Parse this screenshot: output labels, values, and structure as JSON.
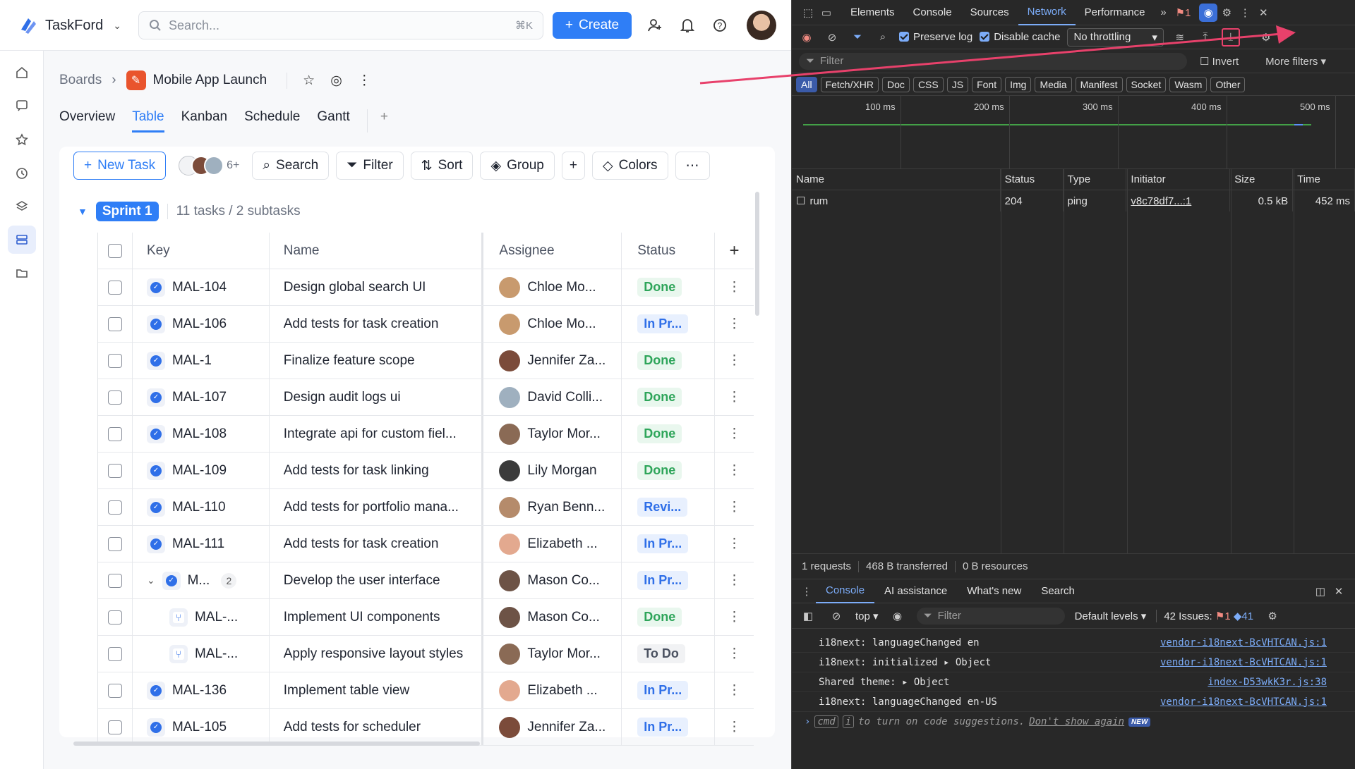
{
  "app": {
    "name": "TaskFord"
  },
  "topbar": {
    "search_placeholder": "Search...",
    "search_shortcut": "⌘K",
    "create_label": "Create"
  },
  "breadcrumb": {
    "root": "Boards",
    "project": "Mobile App Launch"
  },
  "tabs": [
    "Overview",
    "Table",
    "Kanban",
    "Schedule",
    "Gantt"
  ],
  "active_tab": "Table",
  "toolbar": {
    "new_task": "New Task",
    "members_more": "6+",
    "search": "Search",
    "filter": "Filter",
    "sort": "Sort",
    "group": "Group",
    "colors": "Colors"
  },
  "sprint": {
    "name": "Sprint 1",
    "info": "11 tasks / 2 subtasks"
  },
  "table": {
    "headers": {
      "key": "Key",
      "name": "Name",
      "assignee": "Assignee",
      "status": "Status"
    },
    "rows": [
      {
        "key": "MAL-104",
        "name": "Design global search UI",
        "assignee": "Chloe Mo...",
        "status": "Done",
        "avatar_color": "#c89a6e"
      },
      {
        "key": "MAL-106",
        "name": "Add tests for task creation",
        "assignee": "Chloe Mo...",
        "status": "In Pr...",
        "avatar_color": "#c89a6e"
      },
      {
        "key": "MAL-1",
        "name": "Finalize feature scope",
        "assignee": "Jennifer Za...",
        "status": "Done",
        "avatar_color": "#7b4b3a"
      },
      {
        "key": "MAL-107",
        "name": "Design audit logs ui",
        "assignee": "David Colli...",
        "status": "Done",
        "avatar_color": "#9fb0bf"
      },
      {
        "key": "MAL-108",
        "name": "Integrate api for custom fiel...",
        "assignee": "Taylor Mor...",
        "status": "Done",
        "avatar_color": "#8a6a55"
      },
      {
        "key": "MAL-109",
        "name": "Add tests for task linking",
        "assignee": "Lily Morgan",
        "status": "Done",
        "avatar_color": "#3b3b3b"
      },
      {
        "key": "MAL-110",
        "name": "Add tests for portfolio mana...",
        "assignee": "Ryan Benn...",
        "status": "Revi...",
        "avatar_color": "#b58b6b"
      },
      {
        "key": "MAL-111",
        "name": "Add tests for task creation",
        "assignee": "Elizabeth ...",
        "status": "In Pr...",
        "avatar_color": "#e3a98f"
      },
      {
        "key": "M...",
        "name": "Develop the user interface",
        "assignee": "Mason Co...",
        "status": "In Pr...",
        "avatar_color": "#6d5346",
        "parent": true,
        "subcount": "2"
      },
      {
        "key": "MAL-...",
        "name": "Implement UI components",
        "assignee": "Mason Co...",
        "status": "Done",
        "avatar_color": "#6d5346",
        "sub": true
      },
      {
        "key": "MAL-...",
        "name": "Apply responsive layout styles",
        "assignee": "Taylor Mor...",
        "status": "To Do",
        "avatar_color": "#8a6a55",
        "sub": true
      },
      {
        "key": "MAL-136",
        "name": "Implement table view",
        "assignee": "Elizabeth ...",
        "status": "In Pr...",
        "avatar_color": "#e3a98f"
      },
      {
        "key": "MAL-105",
        "name": "Add tests for scheduler",
        "assignee": "Jennifer Za...",
        "status": "In Pr...",
        "avatar_color": "#7b4b3a"
      }
    ]
  },
  "devtools": {
    "tabs": [
      "Elements",
      "Console",
      "Sources",
      "Network",
      "Performance"
    ],
    "active_tab": "Network",
    "issues_badge": "1",
    "preserve_log": "Preserve log",
    "disable_cache": "Disable cache",
    "throttling": "No throttling",
    "filter_placeholder": "Filter",
    "invert": "Invert",
    "more_filters": "More filters",
    "type_filters": [
      "All",
      "Fetch/XHR",
      "Doc",
      "CSS",
      "JS",
      "Font",
      "Img",
      "Media",
      "Manifest",
      "Socket",
      "Wasm",
      "Other"
    ],
    "timeline_labels": [
      "100 ms",
      "200 ms",
      "300 ms",
      "400 ms",
      "500 ms"
    ],
    "columns": [
      "Name",
      "Status",
      "Type",
      "Initiator",
      "Size",
      "Time"
    ],
    "requests": [
      {
        "name": "rum",
        "status": "204",
        "type": "ping",
        "initiator": "v8c78df7...:1",
        "size": "0.5 kB",
        "time": "452 ms"
      }
    ],
    "summary": {
      "requests": "1 requests",
      "transferred": "468 B transferred",
      "resources": "0 B resources"
    },
    "drawer_tabs": [
      "Console",
      "AI assistance",
      "What's new",
      "Search"
    ],
    "console_context": "top",
    "console_filter": "Filter",
    "levels": "Default levels",
    "issues": {
      "label": "42 Issues:",
      "errors": "1",
      "warnings": "41"
    },
    "console_lines": [
      {
        "text": "i18next: languageChanged en",
        "src": "vendor-i18next-BcVHTCAN.js:1"
      },
      {
        "text": "i18next: initialized ▸ Object",
        "src": "vendor-i18next-BcVHTCAN.js:1"
      },
      {
        "text": "Shared theme: ▸ Object",
        "src": "index-D53wkK3r.js:38"
      },
      {
        "text": "i18next: languageChanged en-US",
        "src": "vendor-i18next-BcVHTCAN.js:1"
      }
    ],
    "prompt_hint": "to turn on code suggestions.",
    "prompt_dont_show": "Don't show again",
    "prompt_new": "NEW",
    "prompt_keys": [
      "cmd",
      "i"
    ]
  },
  "colors": {
    "accent": "#2f7ef6",
    "arrow": "#e8416b",
    "done": "#2ea55a"
  }
}
